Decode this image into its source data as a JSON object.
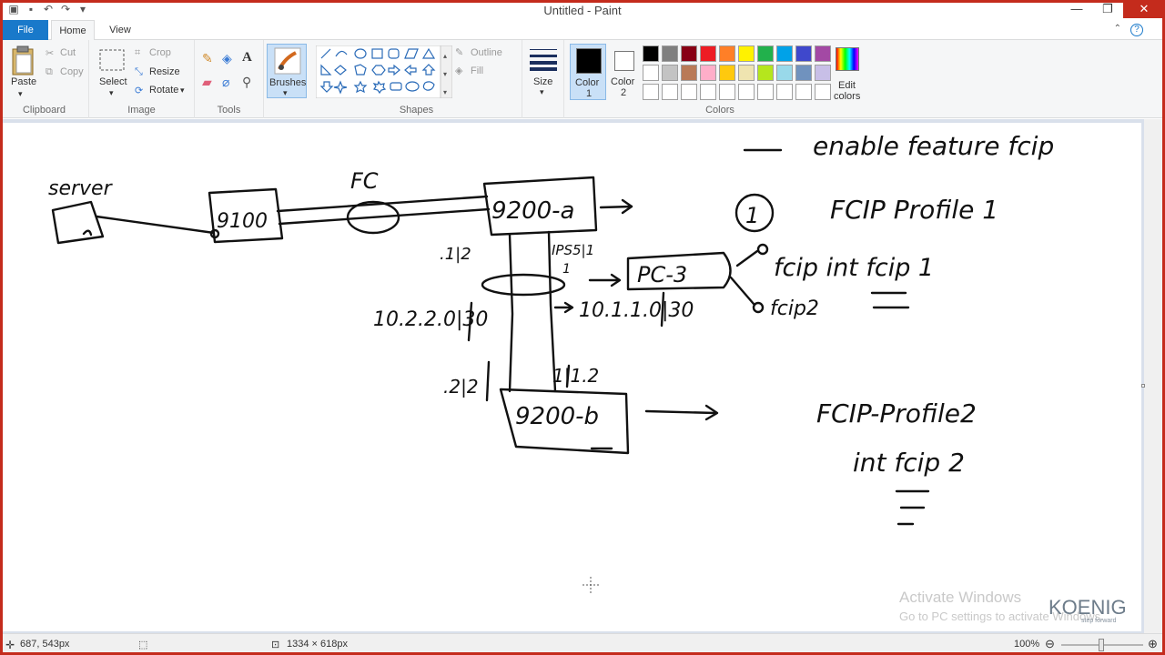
{
  "window": {
    "title": "Untitled - Paint"
  },
  "tabs": {
    "file": "File",
    "home": "Home",
    "view": "View"
  },
  "ribbon": {
    "clipboard": {
      "paste": "Paste",
      "cut": "Cut",
      "copy": "Copy",
      "group": "Clipboard"
    },
    "image": {
      "select": "Select",
      "crop": "Crop",
      "resize": "Resize",
      "rotate": "Rotate",
      "group": "Image"
    },
    "tools": {
      "group": "Tools"
    },
    "brushes": {
      "label": "Brushes"
    },
    "shapes": {
      "outline": "Outline",
      "fill": "Fill",
      "group": "Shapes"
    },
    "size": {
      "label": "Size"
    },
    "color1": {
      "label": "Color",
      "num": "1",
      "value": "#000000"
    },
    "color2": {
      "label": "Color",
      "num": "2",
      "value": "#ffffff"
    },
    "colors": {
      "group": "Colors",
      "edit": "Edit",
      "edit2": "colors",
      "swatches": [
        "#000000",
        "#7f7f7f",
        "#880015",
        "#ed1c24",
        "#ff7f27",
        "#fff200",
        "#22b14c",
        "#00a2e8",
        "#3f48cc",
        "#a349a4",
        "#ffffff",
        "#c3c3c3",
        "#b97a57",
        "#ffaec9",
        "#ffc90e",
        "#efe4b0",
        "#b5e61d",
        "#99d9ea",
        "#7092be",
        "#c8bfe7",
        "#ffffff",
        "#ffffff",
        "#ffffff",
        "#ffffff",
        "#ffffff",
        "#ffffff",
        "#ffffff",
        "#ffffff",
        "#ffffff",
        "#ffffff"
      ]
    }
  },
  "drawing": {
    "server": "server",
    "switch_small": "9100",
    "fc": "FC",
    "switch_a": "9200-a",
    "switch_b": "9200-b",
    "pc": "PC-3",
    "port_a1": ".1|2",
    "port_ip": "IPS5|1",
    "port_1": "1",
    "ip_left": "10.2.2.0|30",
    "ip_right": "10.1.1.0|30",
    "port_b1": ".2|2",
    "port_b2": "1|1.2",
    "note1": "enable feature fcip",
    "circle_num": "1",
    "note2": "FCIP Profile 1",
    "note3": "fcip int fcip 1",
    "note4": "fcip2",
    "note5": "FCIP-Profile2",
    "note6": "int fcip 2"
  },
  "watermark": {
    "line1": "Activate Windows",
    "line2": "Go to PC settings to activate Windows.",
    "logo": "KOENIG",
    "logo_sub": "step forward"
  },
  "status": {
    "cursor": "687, 543px",
    "canvas_size": "1334 × 618px",
    "zoom": "100%"
  }
}
